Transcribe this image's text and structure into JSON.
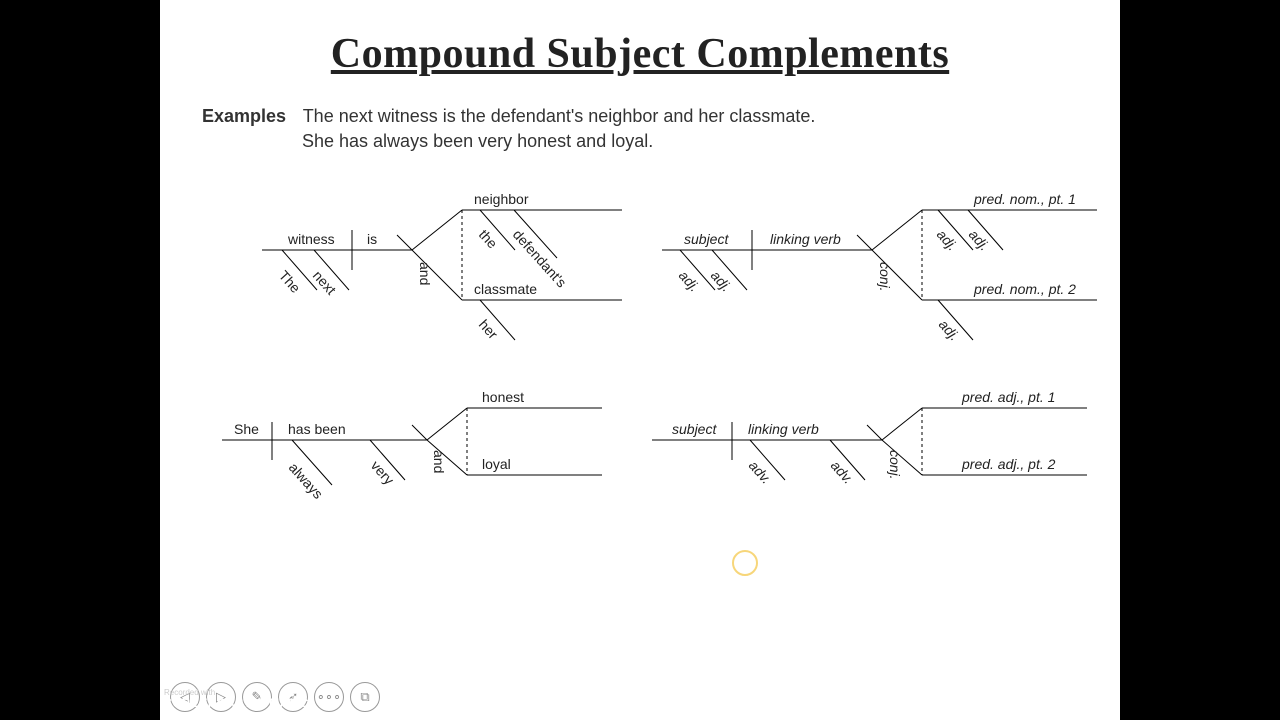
{
  "title": "Compound Subject Complements",
  "examples_label": "Examples",
  "sentence1": "The next witness is the defendant's neighbor and her classmate.",
  "sentence2": "She has always been very honest and loyal.",
  "diagrams": {
    "d1": {
      "subject": "witness",
      "verb": "is",
      "mod1": "The",
      "mod2": "next",
      "conj": "and",
      "comp1": "neighbor",
      "comp1_mod1": "the",
      "comp1_mod2": "defendant's",
      "comp2": "classmate",
      "comp2_mod1": "her"
    },
    "d2": {
      "subject": "subject",
      "verb": "linking verb",
      "mod1": "adj.",
      "mod2": "adj.",
      "conj": "conj.",
      "comp1": "pred. nom., pt. 1",
      "comp1_mod1": "adj.",
      "comp1_mod2": "adj.",
      "comp2": "pred. nom., pt. 2",
      "comp2_mod1": "adj."
    },
    "d3": {
      "subject": "She",
      "verb": "has been",
      "mod1": "always",
      "mod2": "very",
      "conj": "and",
      "comp1": "honest",
      "comp2": "loyal"
    },
    "d4": {
      "subject": "subject",
      "verb": "linking verb",
      "mod1": "adv.",
      "mod2": "adv.",
      "conj": "conj.",
      "comp1": "pred. adj., pt. 1",
      "comp2": "pred. adj., pt. 2"
    }
  },
  "watermark": {
    "recorded": "Recorded with",
    "brand": "SCREENCAST O MATIC"
  },
  "controls": {
    "prev": "◁",
    "play": "▷",
    "pen": "✎",
    "pointer": "➶",
    "more": "∘∘∘",
    "screen": "⧉"
  }
}
